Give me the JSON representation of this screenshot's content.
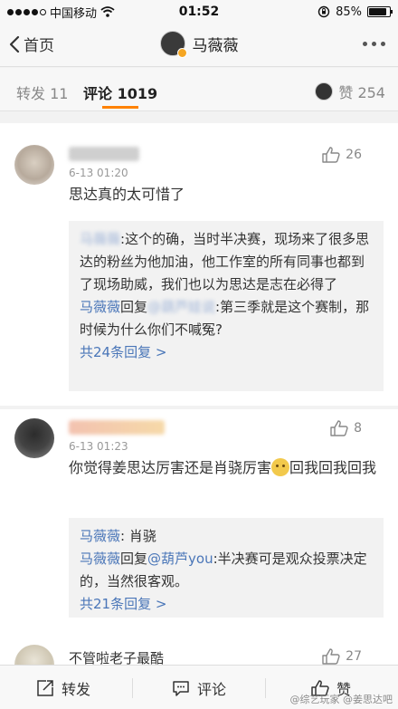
{
  "status": {
    "carrier": "中国移动",
    "time": "01:52",
    "battery": "85%",
    "battery_level": 0.85
  },
  "nav": {
    "back_label": "首页",
    "title": "马薇薇"
  },
  "tabs": {
    "repost": "转发 11",
    "comment": "评论 1019",
    "like": "赞 254"
  },
  "comments": [
    {
      "name": "",
      "time": "6-13 01:20",
      "likes": "26",
      "text": "思达真的太可惜了",
      "replies": [
        {
          "user": "",
          "text": ":这个的确，当时半决赛，现场来了很多思达的粉丝为他加油，他工作室的所有同事也都到了现场助威，我们也以为思达是志在必得了"
        },
        {
          "user": "马薇薇",
          "reply_word": "回复",
          "target": "",
          "text": ":第三季就是这个赛制，那时候为什么你们不喊冤?"
        }
      ],
      "more": "共24条回复 >"
    },
    {
      "name": "",
      "time": "6-13 01:23",
      "likes": "8",
      "text_before": "你觉得姜思达厉害还是肖骁厉害",
      "text_after": "回我回我回我",
      "replies": [
        {
          "user": "马薇薇",
          "text": ": 肖骁"
        },
        {
          "user": "马薇薇",
          "reply_word": "回复",
          "target": "@葫芦you",
          "text": ":半决赛可是观众投票决定的，当然很客观。"
        }
      ],
      "more": "共21条回复 >"
    },
    {
      "name": "不管啦老子最酷",
      "likes": "27"
    }
  ],
  "toolbar": {
    "repost": "转发",
    "comment": "评论",
    "like": "赞"
  },
  "watermark": "@综艺玩家 @姜思达吧"
}
